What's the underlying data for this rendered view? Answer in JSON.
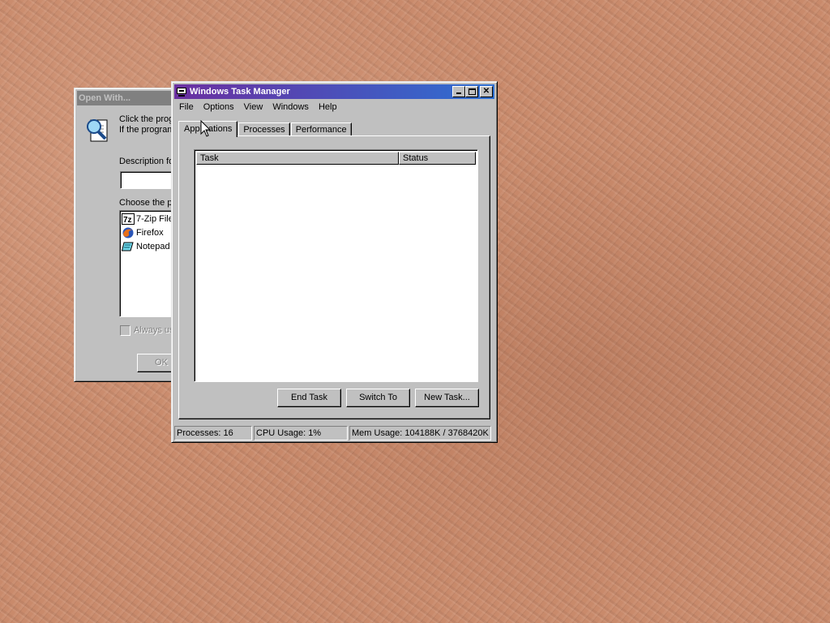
{
  "open_with": {
    "title": "Open With...",
    "instructions_line1": "Click the prog",
    "instructions_line2": "If the program",
    "description_label": "Description fo",
    "description_value": "",
    "choose_label": "Choose the p",
    "programs": [
      {
        "name": "7-Zip File",
        "icon": "7zip-icon"
      },
      {
        "name": "Firefox",
        "icon": "firefox-icon"
      },
      {
        "name": "Notepad",
        "icon": "notepad-icon"
      }
    ],
    "always_use_label": "Always us",
    "ok_label": "OK"
  },
  "task_manager": {
    "title": "Windows Task Manager",
    "menu": [
      "File",
      "Options",
      "View",
      "Windows",
      "Help"
    ],
    "tabs": [
      "Applications",
      "Processes",
      "Performance"
    ],
    "active_tab": "Applications",
    "columns": [
      "Task",
      "Status"
    ],
    "buttons": {
      "end_task": "End Task",
      "switch_to": "Switch To",
      "new_task": "New Task..."
    },
    "status": {
      "processes": "Processes: 16",
      "cpu": "CPU Usage: 1%",
      "mem": "Mem Usage: 104188K / 3768420K"
    }
  },
  "colors": {
    "desktop": "#c98a6b",
    "title_active_left": "#6b2fa0",
    "title_active_right": "#2d6fd2",
    "face": "#c0c0c0"
  }
}
